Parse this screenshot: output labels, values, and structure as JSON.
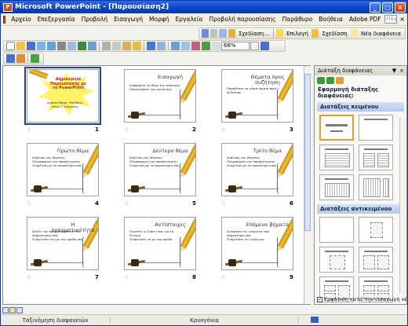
{
  "window": {
    "title": "Microsoft PowerPoint - [Παρουσίαση2]",
    "app_icon_letter": "P",
    "minimize": "_",
    "maximize": "□",
    "close": "×"
  },
  "menu": {
    "items": [
      "Αρχείο",
      "Επεξεργασία",
      "Προβολή",
      "Εισαγωγή",
      "Μορφή",
      "Εργαλεία",
      "Προβολή παρουσίασης",
      "Παράθυρο",
      "Βοήθεια",
      "Adobe PDF"
    ],
    "help_placeholder": "Πληκτρολογήστε ερώτηση",
    "close": "×"
  },
  "toolbar_format": {
    "design_label": "Σχεδίαση...",
    "highlight_label": "Επιλογή",
    "slide_design_label": "Σχεδίαση",
    "new_slide_label": "Νέα διαφάνεια"
  },
  "toolbar_standard": {
    "zoom": "66%"
  },
  "slides": [
    {
      "number": "1",
      "title": "Δημιουργία Παρουσίασης με το PowerPoint",
      "subtitle": "Ιωάννα Μάρη, Υπεύθυνη Νέων Σ Τμήματος",
      "bullets": []
    },
    {
      "number": "2",
      "title": "Εισαγωγή",
      "subtitle": "",
      "bullets": [
        "Αναφέρετε το θέμα της σύσκεψης",
        "Παρουσιάστε τον εαυτό σας"
      ]
    },
    {
      "number": "3",
      "title": "Θέματα προς συζήτηση",
      "subtitle": "",
      "bullets": [
        "Παραθέστε τα κύρια σημεία προς συζήτηση",
        "συζήτηση"
      ]
    },
    {
      "number": "4",
      "title": "Πρώτο θέμα",
      "subtitle": "",
      "bullets": [
        "Ανάλυση του θέματος",
        "Πληροφορίες και παραδείγματα",
        "Συσχέτιση με το ακροατήριο σας"
      ]
    },
    {
      "number": "5",
      "title": "Δεύτερο θέμα",
      "subtitle": "",
      "bullets": [
        "Ανάλυση του θέματος",
        "Πληροφορίες και παραδείγματα",
        "Συσχέτιση με το ακροατήριο σας"
      ]
    },
    {
      "number": "6",
      "title": "Τρίτο θέμα",
      "subtitle": "",
      "bullets": [
        "Ανάλυση του θέματος",
        "Πληροφορίες και παραδείγματα",
        "Συσχέτιση με το ακροατήριο σας"
      ]
    },
    {
      "number": "7",
      "title": "Η πραγματικότητα",
      "subtitle": "",
      "bullets": [
        "Δείξτε την πραγματικότητα του",
        "ακροατηρίου σας",
        "Συσχετίστε την με την ομάδα σας"
      ]
    },
    {
      "number": "8",
      "title": "Αντίστοιχες",
      "subtitle": "",
      "bullets": [
        "Γνωστές οι λύσεις σας για το",
        "ζήτημα",
        "Συσχετίστε τα με την ομάδα"
      ]
    },
    {
      "number": "9",
      "title": "Επόμενα βήματα",
      "subtitle": "",
      "bullets": [
        "Συνοψίστε τις ενέργειες που",
        "ακροατήριο σας",
        "Συσχετίστε τις ενέργειες"
      ]
    }
  ],
  "panel": {
    "header": "Διάταξη διαφάνειας",
    "header_menu": "▼",
    "header_close": "×",
    "apply_label": "Εφαρμογή διάταξης διαφάνειας:",
    "group_text": "Διατάξεις κειμένου",
    "group_objects": "Διατάξεις αντικειμένου",
    "show_on_insert": "Εμφάνιση κατά την εισαγωγή νέων διαφανειών",
    "check_mark": "✓"
  },
  "statusbar": {
    "view": "Ταξινόμηση διαφανειών",
    "design": "Κρυογόνια"
  }
}
